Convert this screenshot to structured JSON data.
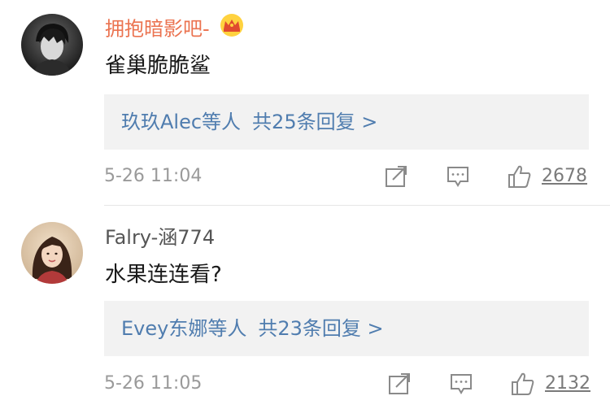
{
  "comments": [
    {
      "username": "拥抱暗影吧-",
      "username_color": "#eb7350",
      "badge_icon": "crown-icon",
      "text": "雀巢脆脆鲨",
      "reply": {
        "who": "玖玖Alec",
        "suffix": "等人",
        "count_text": "共25条回复 >"
      },
      "time": "5-26 11:04",
      "likes": "2678"
    },
    {
      "username": "Falry-涵774",
      "username_color": "#555555",
      "text": "水果连连看?",
      "reply": {
        "who": "Evey东娜",
        "suffix": "等人",
        "count_text": "共23条回复 >"
      },
      "time": "5-26 11:05",
      "likes": "2132"
    }
  ],
  "colors": {
    "link": "#507daf",
    "reply_bg": "#f2f2f2",
    "meta": "#9a9a9a"
  }
}
